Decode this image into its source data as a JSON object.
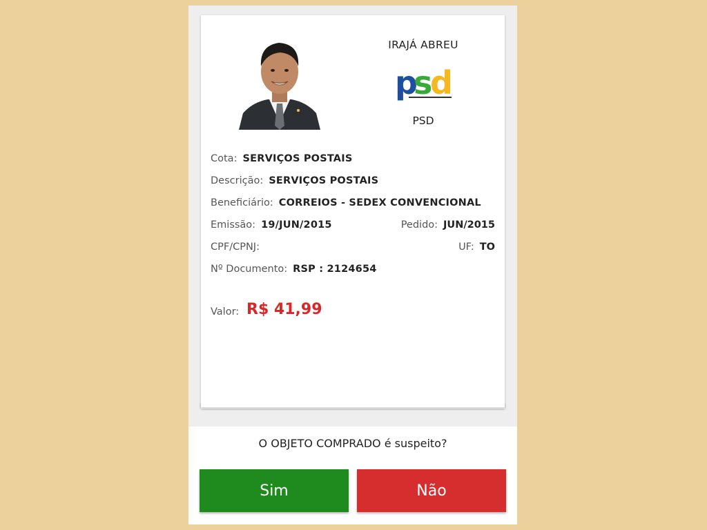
{
  "politician": {
    "name": "IRAJÁ ABREU",
    "party": "PSD",
    "party_logo_text": "psd"
  },
  "expense": {
    "cota_label": "Cota:",
    "cota_value": "SERVIÇOS POSTAIS",
    "descricao_label": "Descrição:",
    "descricao_value": "SERVIÇOS POSTAIS",
    "beneficiario_label": "Beneficiário:",
    "beneficiario_value": "CORREIOS - SEDEX CONVENCIONAL",
    "emissao_label": "Emissão:",
    "emissao_value": "19/JUN/2015",
    "pedido_label": "Pedido:",
    "pedido_value": "JUN/2015",
    "cpf_label": "CPF/CPNJ:",
    "cpf_value": "",
    "uf_label": "UF:",
    "uf_value": "TO",
    "documento_label": "Nº Documento:",
    "documento_value": "RSP : 2124654",
    "valor_label": "Valor:",
    "valor_value": "R$ 41,99"
  },
  "question": {
    "text": "O OBJETO COMPRADO é suspeito?",
    "yes_label": "Sim",
    "no_label": "Não"
  },
  "colors": {
    "background": "#ecd19d",
    "yes_button": "#1f8b1f",
    "no_button": "#d62e2e",
    "valor": "#d62828"
  }
}
